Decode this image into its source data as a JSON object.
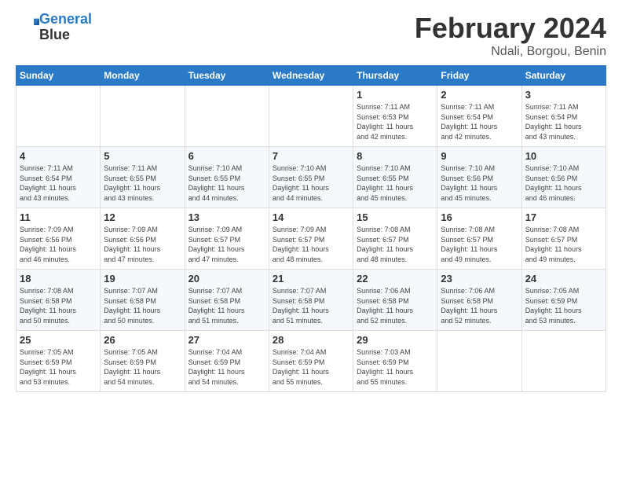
{
  "header": {
    "logo_line1": "General",
    "logo_line2": "Blue",
    "title": "February 2024",
    "subtitle": "Ndali, Borgou, Benin"
  },
  "days_of_week": [
    "Sunday",
    "Monday",
    "Tuesday",
    "Wednesday",
    "Thursday",
    "Friday",
    "Saturday"
  ],
  "weeks": [
    [
      {
        "day": "",
        "info": ""
      },
      {
        "day": "",
        "info": ""
      },
      {
        "day": "",
        "info": ""
      },
      {
        "day": "",
        "info": ""
      },
      {
        "day": "1",
        "info": "Sunrise: 7:11 AM\nSunset: 6:53 PM\nDaylight: 11 hours\nand 42 minutes."
      },
      {
        "day": "2",
        "info": "Sunrise: 7:11 AM\nSunset: 6:54 PM\nDaylight: 11 hours\nand 42 minutes."
      },
      {
        "day": "3",
        "info": "Sunrise: 7:11 AM\nSunset: 6:54 PM\nDaylight: 11 hours\nand 43 minutes."
      }
    ],
    [
      {
        "day": "4",
        "info": "Sunrise: 7:11 AM\nSunset: 6:54 PM\nDaylight: 11 hours\nand 43 minutes."
      },
      {
        "day": "5",
        "info": "Sunrise: 7:11 AM\nSunset: 6:55 PM\nDaylight: 11 hours\nand 43 minutes."
      },
      {
        "day": "6",
        "info": "Sunrise: 7:10 AM\nSunset: 6:55 PM\nDaylight: 11 hours\nand 44 minutes."
      },
      {
        "day": "7",
        "info": "Sunrise: 7:10 AM\nSunset: 6:55 PM\nDaylight: 11 hours\nand 44 minutes."
      },
      {
        "day": "8",
        "info": "Sunrise: 7:10 AM\nSunset: 6:55 PM\nDaylight: 11 hours\nand 45 minutes."
      },
      {
        "day": "9",
        "info": "Sunrise: 7:10 AM\nSunset: 6:56 PM\nDaylight: 11 hours\nand 45 minutes."
      },
      {
        "day": "10",
        "info": "Sunrise: 7:10 AM\nSunset: 6:56 PM\nDaylight: 11 hours\nand 46 minutes."
      }
    ],
    [
      {
        "day": "11",
        "info": "Sunrise: 7:09 AM\nSunset: 6:56 PM\nDaylight: 11 hours\nand 46 minutes."
      },
      {
        "day": "12",
        "info": "Sunrise: 7:09 AM\nSunset: 6:56 PM\nDaylight: 11 hours\nand 47 minutes."
      },
      {
        "day": "13",
        "info": "Sunrise: 7:09 AM\nSunset: 6:57 PM\nDaylight: 11 hours\nand 47 minutes."
      },
      {
        "day": "14",
        "info": "Sunrise: 7:09 AM\nSunset: 6:57 PM\nDaylight: 11 hours\nand 48 minutes."
      },
      {
        "day": "15",
        "info": "Sunrise: 7:08 AM\nSunset: 6:57 PM\nDaylight: 11 hours\nand 48 minutes."
      },
      {
        "day": "16",
        "info": "Sunrise: 7:08 AM\nSunset: 6:57 PM\nDaylight: 11 hours\nand 49 minutes."
      },
      {
        "day": "17",
        "info": "Sunrise: 7:08 AM\nSunset: 6:57 PM\nDaylight: 11 hours\nand 49 minutes."
      }
    ],
    [
      {
        "day": "18",
        "info": "Sunrise: 7:08 AM\nSunset: 6:58 PM\nDaylight: 11 hours\nand 50 minutes."
      },
      {
        "day": "19",
        "info": "Sunrise: 7:07 AM\nSunset: 6:58 PM\nDaylight: 11 hours\nand 50 minutes."
      },
      {
        "day": "20",
        "info": "Sunrise: 7:07 AM\nSunset: 6:58 PM\nDaylight: 11 hours\nand 51 minutes."
      },
      {
        "day": "21",
        "info": "Sunrise: 7:07 AM\nSunset: 6:58 PM\nDaylight: 11 hours\nand 51 minutes."
      },
      {
        "day": "22",
        "info": "Sunrise: 7:06 AM\nSunset: 6:58 PM\nDaylight: 11 hours\nand 52 minutes."
      },
      {
        "day": "23",
        "info": "Sunrise: 7:06 AM\nSunset: 6:58 PM\nDaylight: 11 hours\nand 52 minutes."
      },
      {
        "day": "24",
        "info": "Sunrise: 7:05 AM\nSunset: 6:59 PM\nDaylight: 11 hours\nand 53 minutes."
      }
    ],
    [
      {
        "day": "25",
        "info": "Sunrise: 7:05 AM\nSunset: 6:59 PM\nDaylight: 11 hours\nand 53 minutes."
      },
      {
        "day": "26",
        "info": "Sunrise: 7:05 AM\nSunset: 6:59 PM\nDaylight: 11 hours\nand 54 minutes."
      },
      {
        "day": "27",
        "info": "Sunrise: 7:04 AM\nSunset: 6:59 PM\nDaylight: 11 hours\nand 54 minutes."
      },
      {
        "day": "28",
        "info": "Sunrise: 7:04 AM\nSunset: 6:59 PM\nDaylight: 11 hours\nand 55 minutes."
      },
      {
        "day": "29",
        "info": "Sunrise: 7:03 AM\nSunset: 6:59 PM\nDaylight: 11 hours\nand 55 minutes."
      },
      {
        "day": "",
        "info": ""
      },
      {
        "day": "",
        "info": ""
      }
    ]
  ]
}
